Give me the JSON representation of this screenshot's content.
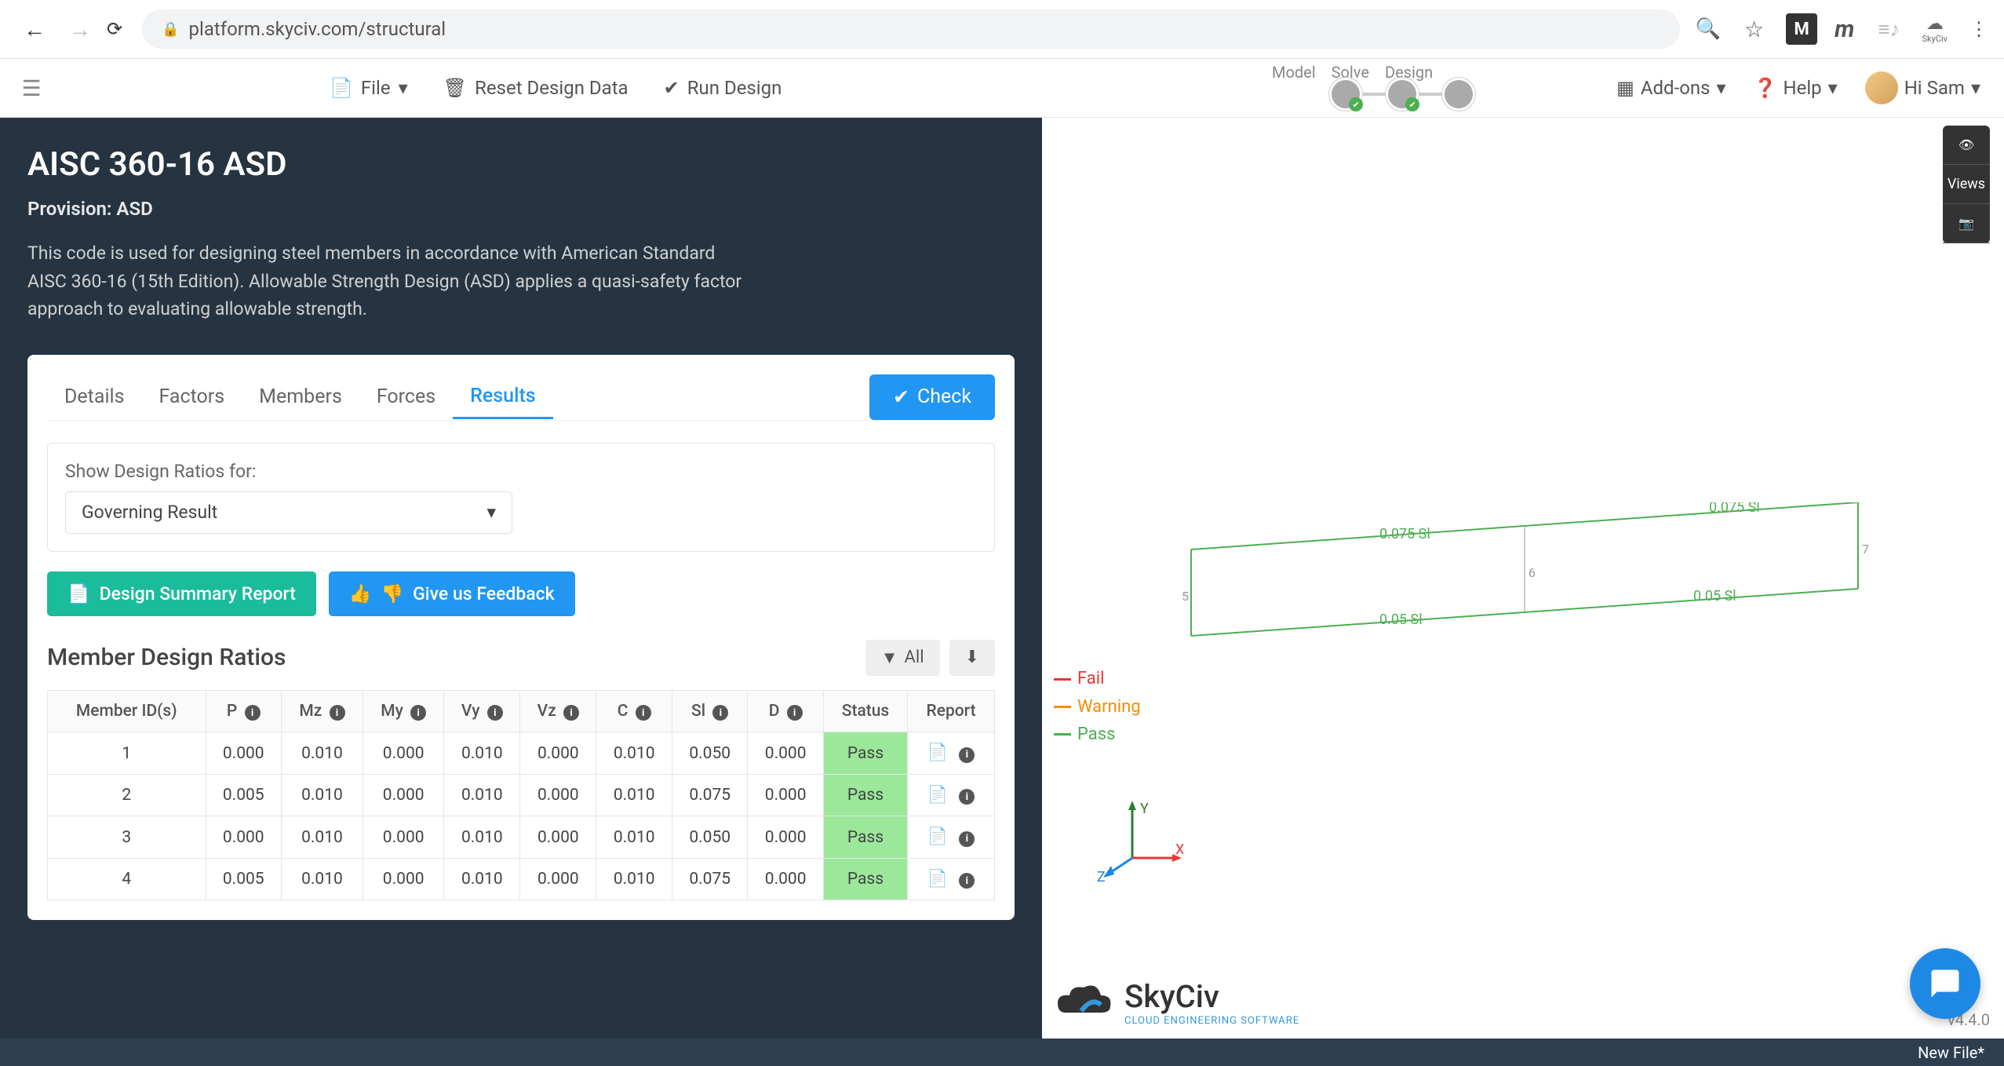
{
  "browser": {
    "url": "platform.skyciv.com/structural"
  },
  "toolbar": {
    "file": "File",
    "reset": "Reset Design Data",
    "run": "Run Design",
    "addons": "Add-ons",
    "help": "Help",
    "greeting": "Hi Sam",
    "pipeline": [
      "Model",
      "Solve",
      "Design"
    ]
  },
  "panel": {
    "title": "AISC 360-16 ASD",
    "subtitle": "Provision: ASD",
    "description": "This code is used for designing steel members in accordance with American Standard AISC 360-16 (15th Edition). Allowable Strength Design (ASD) applies a quasi-safety factor approach to evaluating allowable strength."
  },
  "tabs": [
    "Details",
    "Factors",
    "Members",
    "Forces",
    "Results"
  ],
  "activeTab": "Results",
  "checkBtn": "Check",
  "filter": {
    "label": "Show Design Ratios for:",
    "value": "Governing Result"
  },
  "buttons": {
    "summary": "Design Summary Report",
    "feedback": "Give us Feedback"
  },
  "tableTitle": "Member Design Ratios",
  "allBtn": "All",
  "columns": [
    "Member ID(s)",
    "P",
    "Mz",
    "My",
    "Vy",
    "Vz",
    "C",
    "Sl",
    "D",
    "Status",
    "Report"
  ],
  "rows": [
    {
      "id": "1",
      "P": "0.000",
      "Mz": "0.010",
      "My": "0.000",
      "Vy": "0.010",
      "Vz": "0.000",
      "C": "0.010",
      "Sl": "0.050",
      "D": "0.000",
      "Status": "Pass"
    },
    {
      "id": "2",
      "P": "0.005",
      "Mz": "0.010",
      "My": "0.000",
      "Vy": "0.010",
      "Vz": "0.000",
      "C": "0.010",
      "Sl": "0.075",
      "D": "0.000",
      "Status": "Pass"
    },
    {
      "id": "3",
      "P": "0.000",
      "Mz": "0.010",
      "My": "0.000",
      "Vy": "0.010",
      "Vz": "0.000",
      "C": "0.010",
      "Sl": "0.050",
      "D": "0.000",
      "Status": "Pass"
    },
    {
      "id": "4",
      "P": "0.005",
      "Mz": "0.010",
      "My": "0.000",
      "Vy": "0.010",
      "Vz": "0.000",
      "C": "0.010",
      "Sl": "0.075",
      "D": "0.000",
      "Status": "Pass"
    }
  ],
  "legend": {
    "fail": "Fail",
    "warning": "Warning",
    "pass": "Pass"
  },
  "canvas_labels": {
    "tl": "0.075 Sl",
    "tr": "0.075 Sl",
    "bl": "0.05 Sl",
    "br": "0.05 Sl",
    "n5": "5",
    "n6": "6",
    "n7": "7"
  },
  "sideControls": {
    "views": "Views"
  },
  "logo": {
    "name": "SkyCiv",
    "tag": "CLOUD ENGINEERING SOFTWARE"
  },
  "version": "v4.4.0",
  "footer": "New File*"
}
